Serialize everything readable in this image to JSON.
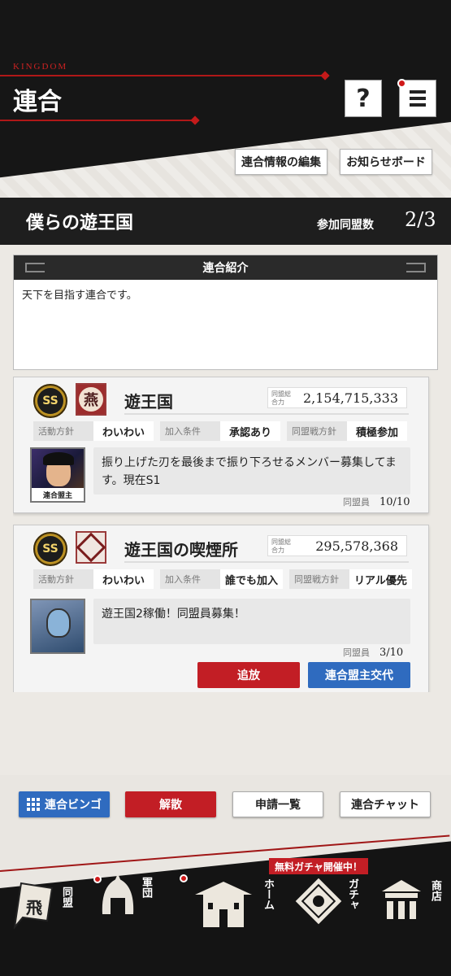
{
  "header": {
    "brand": "KINGDOM",
    "title": "連合",
    "help_label": "?",
    "edit_info_label": "連合情報の編集",
    "notice_board_label": "お知らせボード"
  },
  "alliance": {
    "name": "僕らの遊王国",
    "member_label": "参加同盟数",
    "member_count": "2/3"
  },
  "intro": {
    "heading": "連合紹介",
    "text": "天下を目指す連合です。"
  },
  "leagues": [
    {
      "rank": "SS",
      "crest": "燕",
      "name": "遊王国",
      "power_label": "同盟総合力",
      "power": "2,154,715,333",
      "tags": [
        {
          "k": "活動方針",
          "v": "わいわい"
        },
        {
          "k": "加入条件",
          "v": "承認あり"
        },
        {
          "k": "同盟戦方針",
          "v": "積極参加"
        }
      ],
      "leader_tag": "連合盟主",
      "message": "振り上げた刃を最後まで振り下ろせるメンバー募集してます。現在S1",
      "members_label": "同盟員",
      "members": "10/10"
    },
    {
      "rank": "SS",
      "name": "遊王国の喫煙所",
      "power_label": "同盟総合力",
      "power": "295,578,368",
      "tags": [
        {
          "k": "活動方針",
          "v": "わいわい"
        },
        {
          "k": "加入条件",
          "v": "誰でも加入"
        },
        {
          "k": "同盟戦方針",
          "v": "リアル優先"
        }
      ],
      "message": "遊王国2稼働！同盟員募集！",
      "members_label": "同盟員",
      "members": "3/10",
      "kick_label": "追放",
      "transfer_label": "連合盟主交代"
    }
  ],
  "actions": {
    "bingo": "連合ビンゴ",
    "disband": "解散",
    "requests": "申請一覧",
    "chat": "連合チャット"
  },
  "nav": {
    "promo": "無料ガチャ開催中！",
    "items": [
      {
        "label": "同盟",
        "glyph": "飛"
      },
      {
        "label": "軍団"
      },
      {
        "label": "ホーム"
      },
      {
        "label": "ガチャ"
      },
      {
        "label": "商店"
      }
    ]
  },
  "colors": {
    "accent_red": "#c21e25",
    "accent_blue": "#2f6bbf",
    "dark": "#161616"
  }
}
